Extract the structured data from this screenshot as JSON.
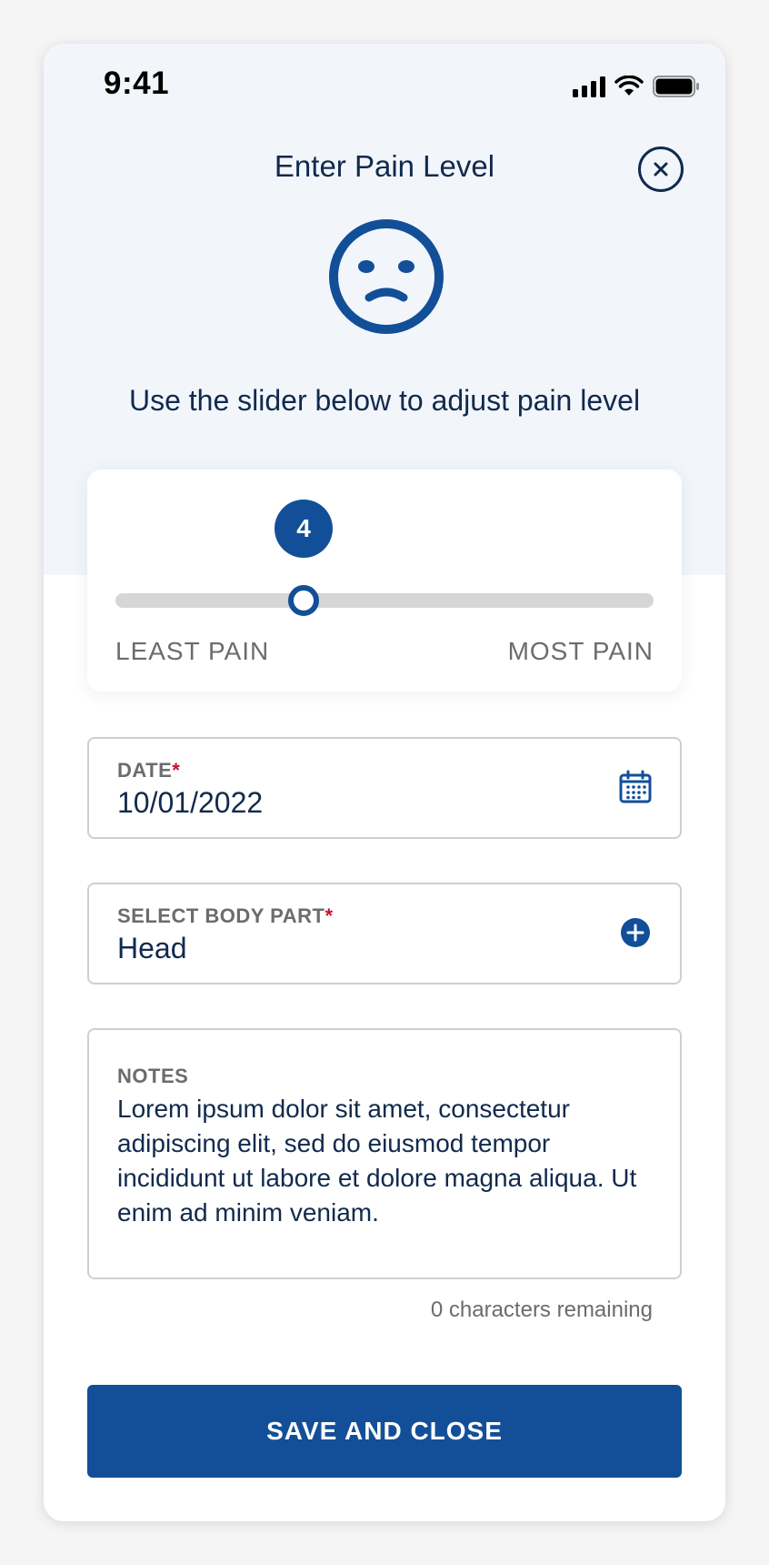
{
  "status_bar": {
    "time": "9:41"
  },
  "header": {
    "title": "Enter Pain Level",
    "close_icon": "close-circle-icon"
  },
  "pain_face_icon": "sad-face-icon",
  "instructions": "Use the slider below to adjust pain level",
  "slider": {
    "value": "4",
    "min": 0,
    "max": 10,
    "min_label": "LEAST PAIN",
    "max_label": "MOST PAIN"
  },
  "date_field": {
    "label": "DATE",
    "required_marker": "*",
    "value": "10/01/2022",
    "icon": "calendar-icon"
  },
  "body_part_field": {
    "label": "SELECT BODY PART",
    "required_marker": "*",
    "value": "Head",
    "icon": "add-circle-icon"
  },
  "notes_field": {
    "label": "NOTES",
    "value": "Lorem ipsum dolor sit amet, consectetur adipiscing elit, sed do eiusmod tempor incididunt ut labore et dolore magna aliqua. Ut enim ad minim veniam.",
    "chars_remaining": "0 characters remaining"
  },
  "save_button": {
    "label": "SAVE AND CLOSE"
  },
  "colors": {
    "primary": "#124f98",
    "text_dark": "#112a4d",
    "required": "#c8102e",
    "header_bg": "#f2f6fb"
  }
}
